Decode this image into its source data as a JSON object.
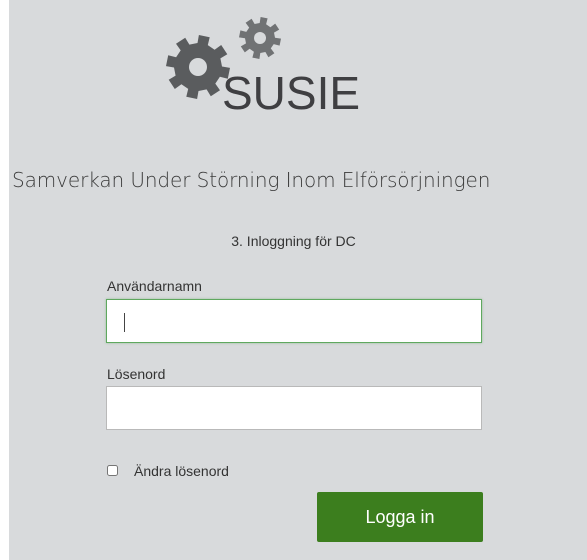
{
  "brand": {
    "logo_text": "SUSIE",
    "subtitle": "Samverkan Under Störning Inom Elförsörjningen",
    "gear_color": "#5a5c5e",
    "gear_small_color": "#707274",
    "icon": "gears-icon"
  },
  "login": {
    "step_label": "3. Inloggning för DC",
    "username_label": "Användarnamn",
    "username_value": "",
    "password_label": "Lösenord",
    "password_value": "",
    "change_password_label": "Ändra lösenord",
    "change_password_checked": false,
    "submit_label": "Logga in",
    "button_color": "#3c7e1e",
    "focus_color": "#5fa85f"
  },
  "colors": {
    "background": "#d8dadc"
  }
}
